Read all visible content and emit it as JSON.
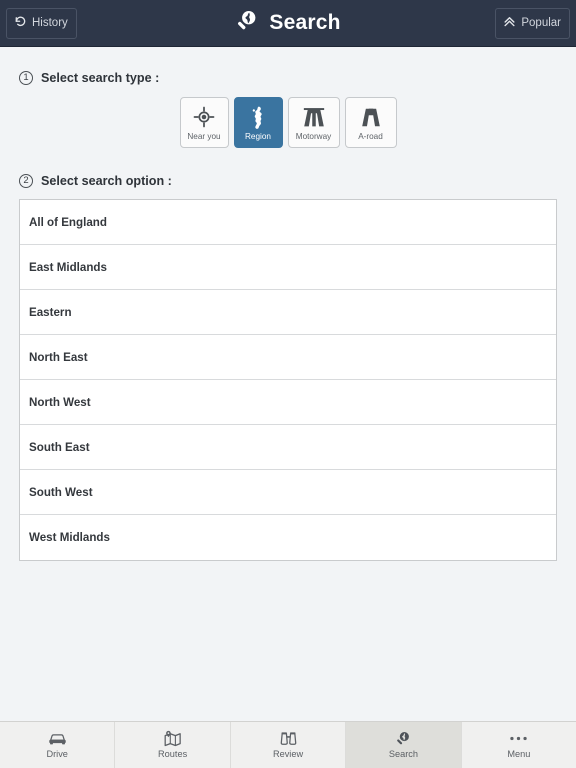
{
  "header": {
    "title": "Search",
    "title_icon": "search-person-icon",
    "left_button": {
      "label": "History",
      "icon": "history-rewind-icon"
    },
    "right_button": {
      "label": "Popular",
      "icon": "double-chevron-up-icon"
    },
    "background_color": "#2e3749"
  },
  "sections": {
    "search_type": {
      "number": "1",
      "label": "Select search type :"
    },
    "search_option": {
      "number": "2",
      "label": "Select search option :"
    }
  },
  "search_types": [
    {
      "label": "Near you",
      "icon": "crosshair-target-icon",
      "selected": false
    },
    {
      "label": "Region",
      "icon": "great-britain-map-icon",
      "selected": true
    },
    {
      "label": "Motorway",
      "icon": "motorway-icon",
      "selected": false
    },
    {
      "label": "A-road",
      "icon": "a-road-icon",
      "selected": false
    }
  ],
  "search_options": [
    {
      "label": "All of England"
    },
    {
      "label": "East Midlands"
    },
    {
      "label": "Eastern"
    },
    {
      "label": "North East"
    },
    {
      "label": "North West"
    },
    {
      "label": "South East"
    },
    {
      "label": "South West"
    },
    {
      "label": "West Midlands"
    }
  ],
  "bottom_nav": [
    {
      "label": "Drive",
      "icon": "car-icon",
      "active": false
    },
    {
      "label": "Routes",
      "icon": "map-pin-icon",
      "active": false
    },
    {
      "label": "Review",
      "icon": "binoculars-icon",
      "active": false
    },
    {
      "label": "Search",
      "icon": "search-person-icon",
      "active": true
    },
    {
      "label": "Menu",
      "icon": "ellipsis-icon",
      "active": false
    }
  ],
  "colors": {
    "header_bg": "#2e3749",
    "accent_selected": "#3a74a0",
    "page_bg": "#f2f4f6",
    "row_bg": "#ffffff",
    "nav_active_bg": "#dededa"
  }
}
